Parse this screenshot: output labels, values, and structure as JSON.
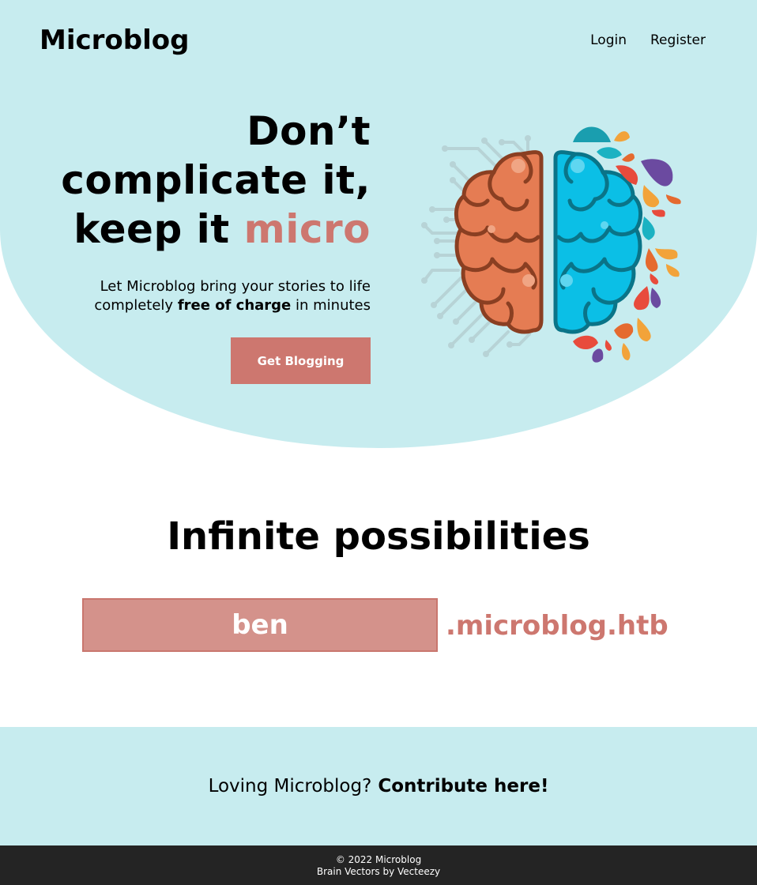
{
  "header": {
    "brand": "Microblog",
    "nav": {
      "login": "Login",
      "register": "Register"
    }
  },
  "hero": {
    "title_line1": "Don’t",
    "title_line2": "complicate it,",
    "title_line3_prefix": "keep it ",
    "title_line3_accent": "micro",
    "subtitle_part1": "Let Microblog bring your stories to life",
    "subtitle_part2": "completely ",
    "subtitle_bold": "free of charge",
    "subtitle_part3": " in minutes",
    "cta_label": "Get Blogging",
    "illustration": "brain-illustration"
  },
  "possibilities": {
    "title": "Infinite possibilities",
    "subdomain_value": "ben",
    "domain_suffix": ".microblog.htb"
  },
  "contribute": {
    "text": "Loving Microblog?",
    "link_label": "Contribute here!"
  },
  "footer": {
    "copyright": "© 2022 Microblog",
    "credit": "Brain Vectors by Vecteezy"
  },
  "colors": {
    "hero_background": "#c7ecef",
    "accent": "#cd776f",
    "input_background": "#d4928b",
    "footer_background": "#242424",
    "brain_left": "#e57c53",
    "brain_right": "#0bbfe6"
  }
}
